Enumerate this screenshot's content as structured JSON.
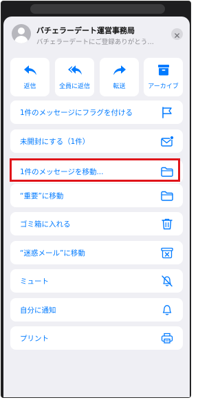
{
  "header": {
    "sender": "バチェラーデート運営事務局",
    "preview": "バチェラーデートにご登録ありがとうござ…",
    "close_icon": "close-icon"
  },
  "quick_actions": [
    {
      "label": "返信",
      "icon": "reply-icon"
    },
    {
      "label": "全員に返信",
      "icon": "reply-all-icon"
    },
    {
      "label": "転送",
      "icon": "forward-icon"
    },
    {
      "label": "アーカイブ",
      "icon": "archive-icon"
    }
  ],
  "menu": [
    {
      "label": "1件のメッセージにフラグを付ける",
      "icon": "flag-icon"
    },
    {
      "label": "未開封にする（1件）",
      "icon": "mark-unread-icon"
    },
    {
      "label": "1件のメッセージを移動...",
      "icon": "folder-icon",
      "highlighted": true
    },
    {
      "label": "“重要”に移動",
      "icon": "folder-icon"
    },
    {
      "label": "ゴミ箱に入れる",
      "icon": "trash-icon"
    },
    {
      "label": "“迷惑メール”に移動",
      "icon": "junk-icon"
    },
    {
      "label": "ミュート",
      "icon": "mute-bell-icon"
    },
    {
      "label": "自分に通知",
      "icon": "bell-icon"
    },
    {
      "label": "プリント",
      "icon": "print-icon"
    }
  ],
  "colors": {
    "accent": "#007aff",
    "highlight": "#e0141a",
    "sheet_background": "#efeff4"
  }
}
